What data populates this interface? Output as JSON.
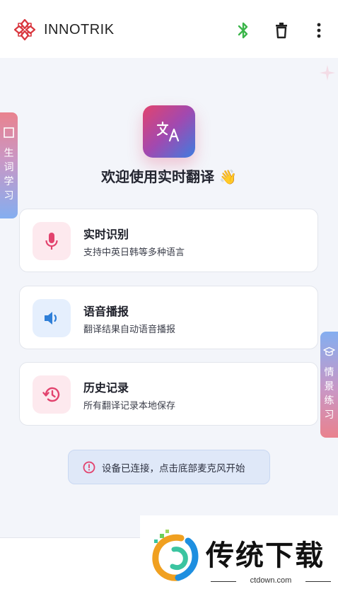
{
  "app": {
    "brand_name": "INNOTRIK",
    "accent_color": "#e2436e",
    "bluetooth_color": "#3bb54a"
  },
  "toolbar": {
    "icons": [
      "bluetooth-icon",
      "delete-icon",
      "more-vert-icon"
    ]
  },
  "hero": {
    "icon": "translate-icon",
    "title": "欢迎使用实时翻译 👋"
  },
  "features": [
    {
      "icon": "microphone-icon",
      "title": "实时识别",
      "subtitle": "支持中英日韩等多种语言"
    },
    {
      "icon": "speaker-icon",
      "title": "语音播报",
      "subtitle": "翻译结果自动语音播报"
    },
    {
      "icon": "history-icon",
      "title": "历史记录",
      "subtitle": "所有翻译记录本地保存"
    }
  ],
  "notice": {
    "icon": "info-icon",
    "text": "设备已连接，点击底部麦克风开始"
  },
  "side_tabs": {
    "left": {
      "icon": "notebook-icon",
      "label": "生词学习"
    },
    "right": {
      "icon": "graduation-cap-icon",
      "label": "情景练习"
    }
  },
  "watermark": {
    "text": "传统下载",
    "url": "ctdown.com"
  }
}
